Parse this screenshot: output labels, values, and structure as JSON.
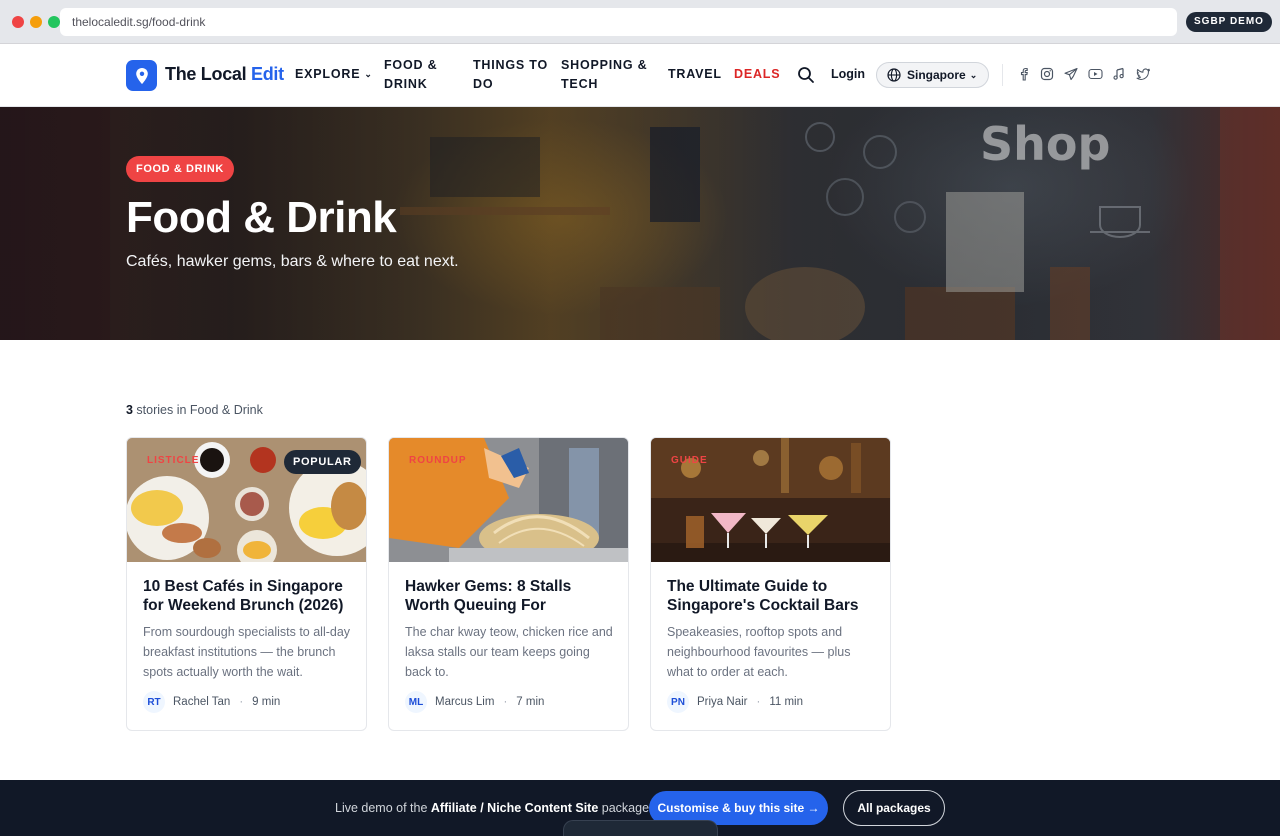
{
  "browser": {
    "url": "thelocaledit.sg/food-drink",
    "badge": "SGBP DEMO"
  },
  "header": {
    "logo_main": "The Local ",
    "logo_accent": "Edit",
    "nav": {
      "explore": "EXPLORE",
      "food_line1": "FOOD &",
      "food_line2": "DRINK",
      "things_line1": "THINGS TO",
      "things_line2": "DO",
      "shopping_line1": "SHOPPING &",
      "shopping_line2": "TECH",
      "travel": "TRAVEL",
      "deals": "DEALS"
    },
    "login": "Login",
    "region": "Singapore",
    "social_icons": [
      "facebook-icon",
      "instagram-icon",
      "telegram-icon",
      "youtube-icon",
      "tiktok-icon",
      "twitter-icon"
    ]
  },
  "hero": {
    "badge": "FOOD & DRINK",
    "title": "Food & Drink",
    "subtitle": "Cafés, hawker gems, bars & where to eat next.",
    "background_sign": "Shop"
  },
  "listing": {
    "count": "3",
    "count_suffix": " stories in Food & Drink",
    "cards": [
      {
        "category": "LISTICLE",
        "popular": "POPULAR",
        "title": "10 Best Cafés in Singapore for Weekend Brunch (2026)",
        "description": "From sourdough specialists to all-day breakfast institutions — the brunch spots actually worth the wait.",
        "initials": "RT",
        "author": "Rachel Tan",
        "read_time": "9 min"
      },
      {
        "category": "ROUNDUP",
        "title": "Hawker Gems: 8 Stalls Worth Queuing For",
        "description": "The char kway teow, chicken rice and laksa stalls our team keeps going back to.",
        "initials": "ML",
        "author": "Marcus Lim",
        "read_time": "7 min"
      },
      {
        "category": "GUIDE",
        "title": "The Ultimate Guide to Singapore's Cocktail Bars",
        "description": "Speakeasies, rooftop spots and neighbourhood favourites — plus what to order at each.",
        "initials": "PN",
        "author": "Priya Nair",
        "read_time": "11 min"
      }
    ]
  },
  "demo_bar": {
    "text_prefix": "Live demo of the ",
    "package_name": "Affiliate / Niche Content Site",
    "text_suffix": " package.",
    "primary_button": "Customise & buy this site →",
    "secondary_button": "All packages"
  },
  "colors": {
    "brand": "#2563eb",
    "accent_red": "#ef4444",
    "deals": "#dc2626",
    "footer_bg": "#111827"
  }
}
